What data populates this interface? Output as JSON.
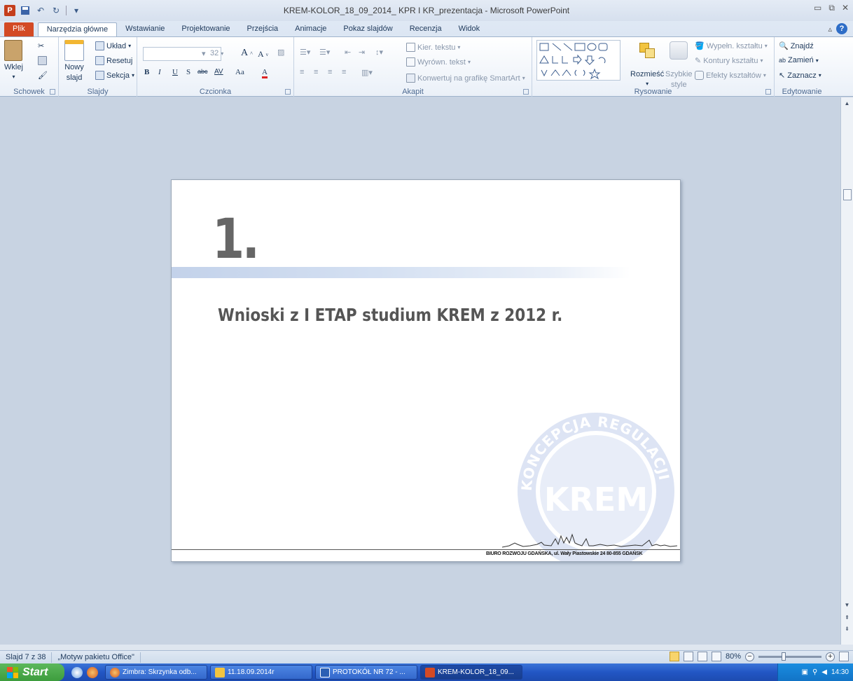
{
  "window": {
    "title": "KREM-KOLOR_18_09_2014_ KPR I KR_prezentacja  -  Microsoft PowerPoint"
  },
  "tabs": [
    "Plik",
    "Narzędzia główne",
    "Wstawianie",
    "Projektowanie",
    "Przejścia",
    "Animacje",
    "Pokaz slajdów",
    "Recenzja",
    "Widok"
  ],
  "ribbon": {
    "schowek": {
      "label": "Schowek",
      "paste": "Wklej"
    },
    "slajdy": {
      "label": "Slajdy",
      "new_slide_1": "Nowy",
      "new_slide_2": "slajd",
      "layout": "Układ",
      "reset": "Resetuj",
      "section": "Sekcja"
    },
    "czcionka": {
      "label": "Czcionka",
      "font_size": "32",
      "grow": "A",
      "shrink": "A",
      "bold": "B",
      "italic": "I",
      "underline": "U",
      "shadow": "S",
      "strike": "abc",
      "spacing": "AV",
      "case": "Aa",
      "color": "A"
    },
    "akapit": {
      "label": "Akapit",
      "text_dir": "Kier. tekstu",
      "align_text": "Wyrówn. tekst",
      "smartart": "Konwertuj na grafikę SmartArt"
    },
    "rysowanie": {
      "label": "Rysowanie",
      "arrange": "Rozmieść",
      "quick_styles_1": "Szybkie",
      "quick_styles_2": "style",
      "fill": "Wypełn. kształtu",
      "outline": "Kontury kształtu",
      "effects": "Efekty kształtów"
    },
    "edytowanie": {
      "label": "Edytowanie",
      "find": "Znajdź",
      "replace": "Zamień",
      "select": "Zaznacz"
    }
  },
  "slide": {
    "number": "1.",
    "title": "Wnioski z I ETAP studium KREM z 2012 r.",
    "logo_text": "KREM",
    "logo_ring_text": "KONCEPCJA REGULACJI ESTETYZACJI",
    "footer": "BIURO ROZWOJU GDAŃSKA, ul. Wały Piastowskie 24  80-855 GDAŃSK"
  },
  "status": {
    "slide_info": "Slajd 7 z 38",
    "theme": "„Motyw pakietu Office\"",
    "zoom": "80%"
  },
  "taskbar": {
    "start": "Start",
    "items": [
      "Zimbra: Skrzynka odb...",
      "11.18.09.2014r",
      "PROTOKÓŁ NR  72 - ...",
      "KREM-KOLOR_18_09..."
    ],
    "clock": "14:30"
  },
  "colors": {
    "file_tab": "#d34a25",
    "accent_band": "#c3d2ea",
    "logo": "#b9c6e6"
  }
}
